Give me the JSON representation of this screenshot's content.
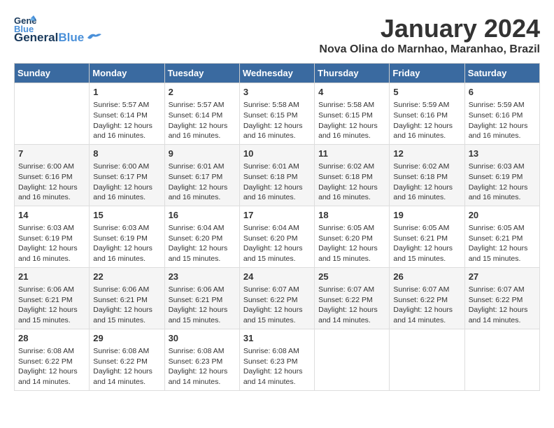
{
  "header": {
    "logo_general": "General",
    "logo_blue": "Blue",
    "month": "January 2024",
    "location": "Nova Olina do Marnhao, Maranhao, Brazil"
  },
  "weekdays": [
    "Sunday",
    "Monday",
    "Tuesday",
    "Wednesday",
    "Thursday",
    "Friday",
    "Saturday"
  ],
  "weeks": [
    [
      {
        "day": "",
        "info": ""
      },
      {
        "day": "1",
        "info": "Sunrise: 5:57 AM\nSunset: 6:14 PM\nDaylight: 12 hours and 16 minutes."
      },
      {
        "day": "2",
        "info": "Sunrise: 5:57 AM\nSunset: 6:14 PM\nDaylight: 12 hours and 16 minutes."
      },
      {
        "day": "3",
        "info": "Sunrise: 5:58 AM\nSunset: 6:15 PM\nDaylight: 12 hours and 16 minutes."
      },
      {
        "day": "4",
        "info": "Sunrise: 5:58 AM\nSunset: 6:15 PM\nDaylight: 12 hours and 16 minutes."
      },
      {
        "day": "5",
        "info": "Sunrise: 5:59 AM\nSunset: 6:16 PM\nDaylight: 12 hours and 16 minutes."
      },
      {
        "day": "6",
        "info": "Sunrise: 5:59 AM\nSunset: 6:16 PM\nDaylight: 12 hours and 16 minutes."
      }
    ],
    [
      {
        "day": "7",
        "info": "Sunrise: 6:00 AM\nSunset: 6:16 PM\nDaylight: 12 hours and 16 minutes."
      },
      {
        "day": "8",
        "info": "Sunrise: 6:00 AM\nSunset: 6:17 PM\nDaylight: 12 hours and 16 minutes."
      },
      {
        "day": "9",
        "info": "Sunrise: 6:01 AM\nSunset: 6:17 PM\nDaylight: 12 hours and 16 minutes."
      },
      {
        "day": "10",
        "info": "Sunrise: 6:01 AM\nSunset: 6:18 PM\nDaylight: 12 hours and 16 minutes."
      },
      {
        "day": "11",
        "info": "Sunrise: 6:02 AM\nSunset: 6:18 PM\nDaylight: 12 hours and 16 minutes."
      },
      {
        "day": "12",
        "info": "Sunrise: 6:02 AM\nSunset: 6:18 PM\nDaylight: 12 hours and 16 minutes."
      },
      {
        "day": "13",
        "info": "Sunrise: 6:03 AM\nSunset: 6:19 PM\nDaylight: 12 hours and 16 minutes."
      }
    ],
    [
      {
        "day": "14",
        "info": "Sunrise: 6:03 AM\nSunset: 6:19 PM\nDaylight: 12 hours and 16 minutes."
      },
      {
        "day": "15",
        "info": "Sunrise: 6:03 AM\nSunset: 6:19 PM\nDaylight: 12 hours and 16 minutes."
      },
      {
        "day": "16",
        "info": "Sunrise: 6:04 AM\nSunset: 6:20 PM\nDaylight: 12 hours and 15 minutes."
      },
      {
        "day": "17",
        "info": "Sunrise: 6:04 AM\nSunset: 6:20 PM\nDaylight: 12 hours and 15 minutes."
      },
      {
        "day": "18",
        "info": "Sunrise: 6:05 AM\nSunset: 6:20 PM\nDaylight: 12 hours and 15 minutes."
      },
      {
        "day": "19",
        "info": "Sunrise: 6:05 AM\nSunset: 6:21 PM\nDaylight: 12 hours and 15 minutes."
      },
      {
        "day": "20",
        "info": "Sunrise: 6:05 AM\nSunset: 6:21 PM\nDaylight: 12 hours and 15 minutes."
      }
    ],
    [
      {
        "day": "21",
        "info": "Sunrise: 6:06 AM\nSunset: 6:21 PM\nDaylight: 12 hours and 15 minutes."
      },
      {
        "day": "22",
        "info": "Sunrise: 6:06 AM\nSunset: 6:21 PM\nDaylight: 12 hours and 15 minutes."
      },
      {
        "day": "23",
        "info": "Sunrise: 6:06 AM\nSunset: 6:21 PM\nDaylight: 12 hours and 15 minutes."
      },
      {
        "day": "24",
        "info": "Sunrise: 6:07 AM\nSunset: 6:22 PM\nDaylight: 12 hours and 15 minutes."
      },
      {
        "day": "25",
        "info": "Sunrise: 6:07 AM\nSunset: 6:22 PM\nDaylight: 12 hours and 14 minutes."
      },
      {
        "day": "26",
        "info": "Sunrise: 6:07 AM\nSunset: 6:22 PM\nDaylight: 12 hours and 14 minutes."
      },
      {
        "day": "27",
        "info": "Sunrise: 6:07 AM\nSunset: 6:22 PM\nDaylight: 12 hours and 14 minutes."
      }
    ],
    [
      {
        "day": "28",
        "info": "Sunrise: 6:08 AM\nSunset: 6:22 PM\nDaylight: 12 hours and 14 minutes."
      },
      {
        "day": "29",
        "info": "Sunrise: 6:08 AM\nSunset: 6:22 PM\nDaylight: 12 hours and 14 minutes."
      },
      {
        "day": "30",
        "info": "Sunrise: 6:08 AM\nSunset: 6:23 PM\nDaylight: 12 hours and 14 minutes."
      },
      {
        "day": "31",
        "info": "Sunrise: 6:08 AM\nSunset: 6:23 PM\nDaylight: 12 hours and 14 minutes."
      },
      {
        "day": "",
        "info": ""
      },
      {
        "day": "",
        "info": ""
      },
      {
        "day": "",
        "info": ""
      }
    ]
  ]
}
